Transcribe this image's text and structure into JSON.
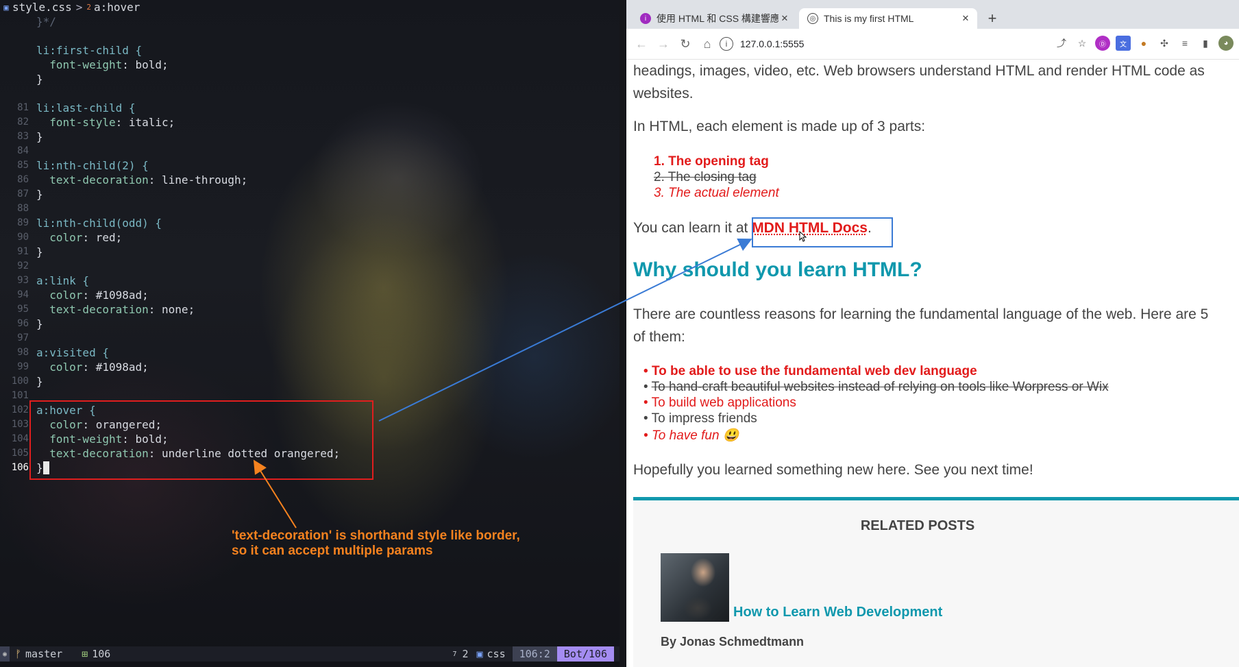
{
  "editor": {
    "breadcrumb": {
      "file": "style.css",
      "separator": ">",
      "level": "2",
      "selector": "a:hover"
    },
    "lines": [
      {
        "n": "",
        "t": "}*/",
        "cls": "comment"
      },
      {
        "n": "",
        "t": "",
        "cls": ""
      },
      {
        "n": "",
        "t": "li:first-child {",
        "cls": "sel"
      },
      {
        "n": "",
        "t": "  font-weight: bold;",
        "cls": "decl"
      },
      {
        "n": "",
        "t": "}",
        "cls": "br"
      },
      {
        "n": "",
        "t": "",
        "cls": ""
      },
      {
        "n": "81",
        "t": "li:last-child {",
        "cls": "sel"
      },
      {
        "n": "82",
        "t": "  font-style: italic;",
        "cls": "decl"
      },
      {
        "n": "83",
        "t": "}",
        "cls": "br"
      },
      {
        "n": "84",
        "t": "",
        "cls": ""
      },
      {
        "n": "85",
        "t": "li:nth-child(2) {",
        "cls": "sel"
      },
      {
        "n": "86",
        "t": "  text-decoration: line-through;",
        "cls": "decl"
      },
      {
        "n": "87",
        "t": "}",
        "cls": "br"
      },
      {
        "n": "88",
        "t": "",
        "cls": ""
      },
      {
        "n": "89",
        "t": "li:nth-child(odd) {",
        "cls": "sel"
      },
      {
        "n": "90",
        "t": "  color: red;",
        "cls": "decl"
      },
      {
        "n": "91",
        "t": "}",
        "cls": "br"
      },
      {
        "n": "92",
        "t": "",
        "cls": ""
      },
      {
        "n": "93",
        "t": "a:link {",
        "cls": "sel"
      },
      {
        "n": "94",
        "t": "  color: #1098ad;",
        "cls": "decl"
      },
      {
        "n": "95",
        "t": "  text-decoration: none;",
        "cls": "decl"
      },
      {
        "n": "96",
        "t": "}",
        "cls": "br"
      },
      {
        "n": "97",
        "t": "",
        "cls": ""
      },
      {
        "n": "98",
        "t": "a:visited {",
        "cls": "sel"
      },
      {
        "n": "99",
        "t": "  color: #1098ad;",
        "cls": "decl"
      },
      {
        "n": "100",
        "t": "}",
        "cls": "br"
      },
      {
        "n": "101",
        "t": "",
        "cls": ""
      },
      {
        "n": "102",
        "t": "a:hover {",
        "cls": "sel"
      },
      {
        "n": "103",
        "t": "  color: orangered;",
        "cls": "decl"
      },
      {
        "n": "104",
        "t": "  font-weight: bold;",
        "cls": "decl"
      },
      {
        "n": "105",
        "t": "  text-decoration: underline dotted orangered;",
        "cls": "decl"
      },
      {
        "n": "106",
        "t": "}",
        "cls": "cur"
      }
    ],
    "annotation": "'text-decoration' is shorthand style like border,\nso it can accept multiple params",
    "status": {
      "branch": "master",
      "lines": "106",
      "sup": "7",
      "count": "2",
      "filetype": "css",
      "position": "106:2",
      "percent": "Bot/106"
    }
  },
  "browser": {
    "tabs": [
      {
        "title": "使用 HTML 和 CSS 構建響應",
        "favicon_color": "#a02bc0"
      },
      {
        "title": "This is my first HTML",
        "favicon_color": "#3c3c3c"
      }
    ],
    "url": "127.0.0.1:5555",
    "page": {
      "intro_line1": "headings, images, video, etc. Web browsers understand HTML and render HTML code as",
      "intro_line2": "websites.",
      "parts_intro": "In HTML, each element is made up of 3 parts:",
      "parts": [
        "1. The opening tag",
        "2. The closing tag",
        "3. The actual element"
      ],
      "learn_prefix": "You can learn it at ",
      "link_text": "MDN HTML Docs",
      "learn_suffix": ".",
      "heading": "Why should you learn HTML?",
      "reasons_intro_1": "There are countless reasons for learning the fundamental language of the web. Here are 5",
      "reasons_intro_2": "of them:",
      "reasons": [
        "To be able to use the fundamental web dev language",
        "To hand-craft beautiful websites instead of relying on tools like Worpress or Wix",
        "To build web applications",
        "To impress friends",
        "To have fun 😃"
      ],
      "outro": "Hopefully you learned something new here. See you next time!",
      "related_title": "RELATED POSTS",
      "post_title": "How to Learn Web Development",
      "post_author": "By Jonas Schmedtmann"
    }
  },
  "colors": {
    "accent_teal": "#1098ad",
    "red": "#e21b1b",
    "annotation_orange": "#f5821f",
    "highlight_box": "#e01e1e",
    "link_box": "#3a7bd5"
  }
}
